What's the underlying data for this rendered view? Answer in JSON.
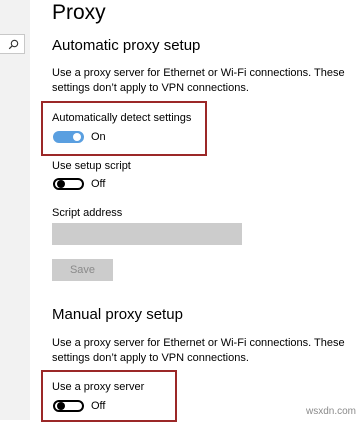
{
  "header": {
    "title": "Proxy"
  },
  "automatic": {
    "section_title": "Automatic proxy setup",
    "description": "Use a proxy server for Ethernet or Wi-Fi connections. These settings don’t apply to VPN connections.",
    "detect_label": "Automatically detect settings",
    "detect_state": "On",
    "script_label": "Use setup script",
    "script_state": "Off",
    "script_address_label": "Script address",
    "script_address_value": "",
    "save_label": "Save"
  },
  "manual": {
    "section_title": "Manual proxy setup",
    "description": "Use a proxy server for Ethernet or Wi-Fi connections. These settings don’t apply to VPN connections.",
    "proxy_label": "Use a proxy server",
    "proxy_state": "Off"
  },
  "watermark": "wsxdn.com",
  "icons": {
    "search": "search-icon"
  },
  "colors": {
    "accent": "#5a9fe0",
    "highlight": "#9b2828"
  }
}
